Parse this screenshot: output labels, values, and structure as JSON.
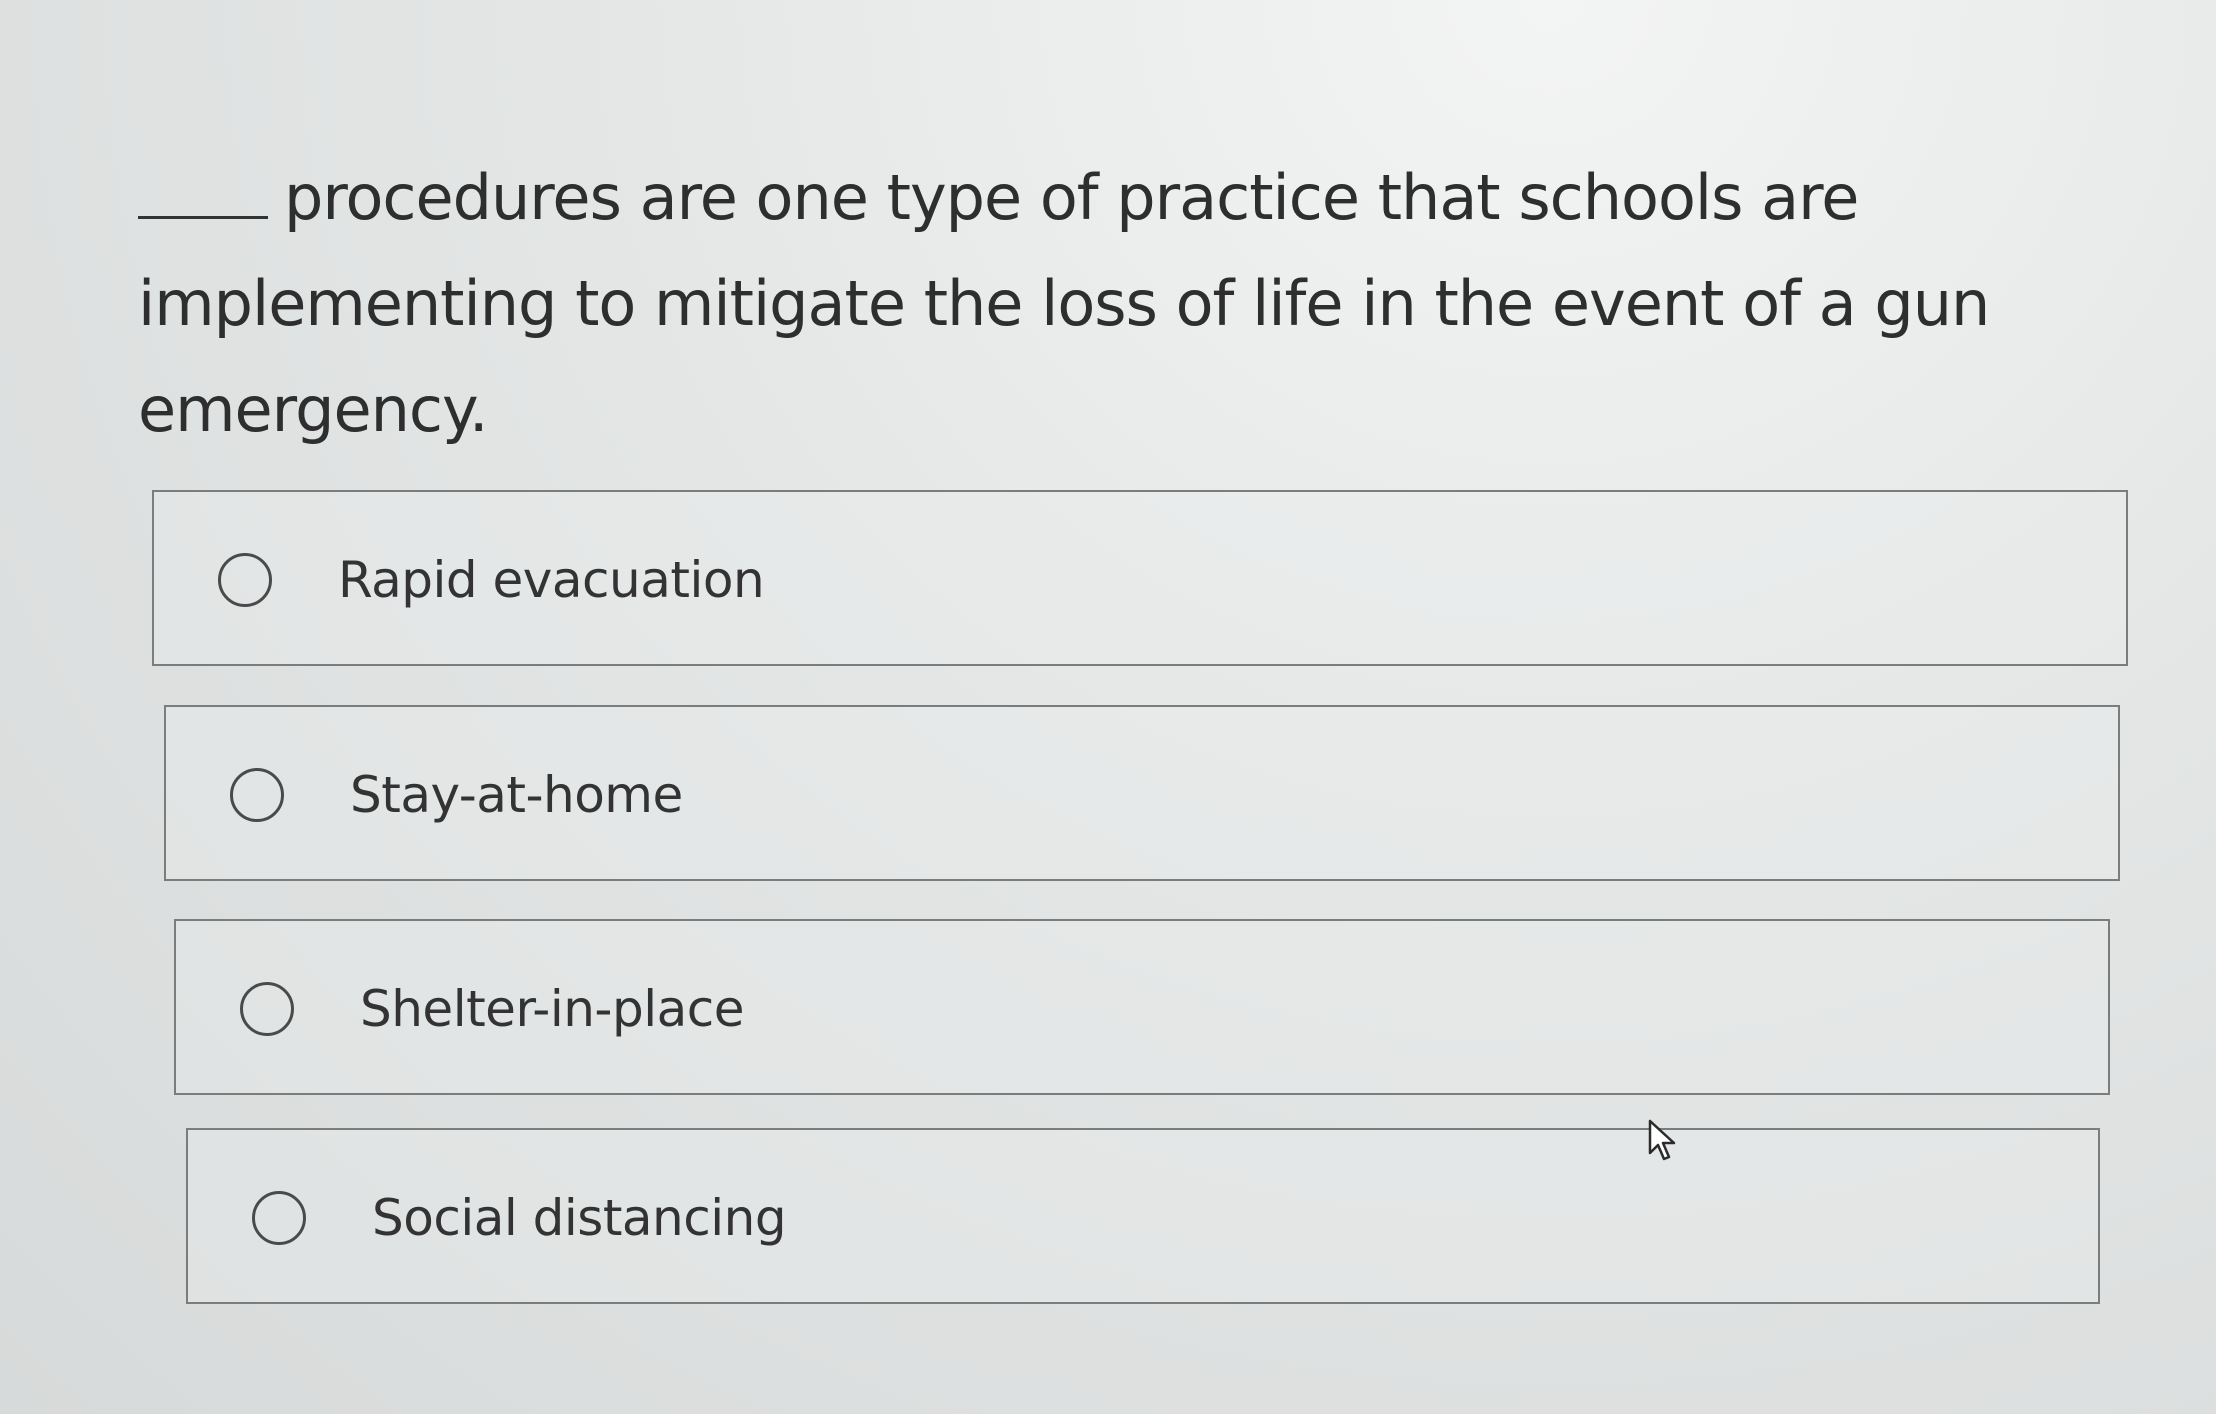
{
  "question": {
    "text": "procedures are one type of practice that schools are implementing to mitigate the loss of life in the event of a gun emergency."
  },
  "options": [
    {
      "label": "Rapid evacuation",
      "selected": false
    },
    {
      "label": "Stay-at-home",
      "selected": false
    },
    {
      "label": "Shelter-in-place",
      "selected": false
    },
    {
      "label": "Social distancing",
      "selected": false
    }
  ],
  "icons": {
    "radio": "radio-unchecked-icon",
    "cursor": "mouse-pointer-icon"
  },
  "colors": {
    "background": "#e2e4e4",
    "border": "#7b7d7d",
    "text": "#2e2e2e"
  }
}
